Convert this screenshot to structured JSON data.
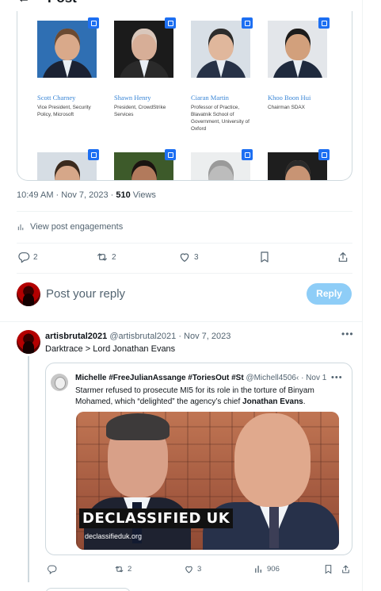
{
  "header": {
    "title": "Post",
    "back_icon": "arrow-left-icon"
  },
  "media_people": [
    {
      "name": "Scott Charney",
      "role": "Vice President, Security Policy, Microsoft",
      "photo_bg": "#2f6fb3",
      "skin": "#d9a98a",
      "hair": "#6b4a32",
      "suit": "#1b2233"
    },
    {
      "name": "Shawn Henry",
      "role": "President, CrowdStrike Services",
      "photo_bg": "#1b1b1b",
      "skin": "#d7ae97",
      "hair": "#d9c7bb",
      "suit": "#2a2a2a"
    },
    {
      "name": "Ciaran Martin",
      "role": "Professor of Practice, Blavatnik School of Government, University of Oxford",
      "photo_bg": "#d8dfe6",
      "skin": "#e0b79c",
      "hair": "#2c2c2c",
      "suit": "#273247"
    },
    {
      "name": "Khoo Boon Hui",
      "role": "Chairman SDAX",
      "photo_bg": "#e3e6ea",
      "skin": "#d2a07c",
      "hair": "#1c1c1c",
      "suit": "#1f2a3d"
    }
  ],
  "media_people_row2": [
    {
      "photo_bg": "#d6dde4",
      "skin": "#d6a789",
      "hair": "#3a2a1e",
      "suit": "#3a4a5a"
    },
    {
      "photo_bg": "#3d5a2a",
      "skin": "#b27a5c",
      "hair": "#1a1410",
      "suit": "#4a2a2a"
    },
    {
      "photo_bg": "#eceeef",
      "skin": "#bcbcbc",
      "hair": "#9a9a9a",
      "suit": "#555"
    },
    {
      "photo_bg": "#1e1e1e",
      "skin": "#c89474",
      "hair": "#2a2a2a",
      "suit": "#333"
    }
  ],
  "meta": {
    "time": "10:49 AM · Nov 7, 2023 · ",
    "views_count": "510",
    "views_label": " Views"
  },
  "engagements_label": "View post engagements",
  "actions": {
    "replies": "2",
    "reposts": "2",
    "likes": "3"
  },
  "composer": {
    "placeholder": "Post your reply",
    "button": "Reply"
  },
  "reply": {
    "name": "artisbrutal2021",
    "handle": "@artisbrutal2021 · Nov 7, 2023",
    "text": "Darktrace > Lord Jonathan Evans",
    "actions": {
      "replies": "",
      "reposts": "2",
      "likes": "3",
      "views": "906"
    }
  },
  "quote": {
    "name": "Michelle #FreeJulianAssange #ToriesOut #St",
    "handle": "@Michell4506‹ · Nov 1",
    "text_before": "Starmer refused to prosecute MI5 for its role in the torture of Binyam Mohamed, which “delighted” the agency’s chief ",
    "text_bold": "Jonathan Evans",
    "text_after": ".",
    "image_banner": "DECLASSIFIED UK",
    "image_site": "declassifieduk.org"
  },
  "colors": {
    "accent": "#1d9bf0",
    "reply_button_disabled": "#8ecdf7",
    "muted": "#536471",
    "link_name": "#3a86d6",
    "badge": "#1d6ff2"
  }
}
